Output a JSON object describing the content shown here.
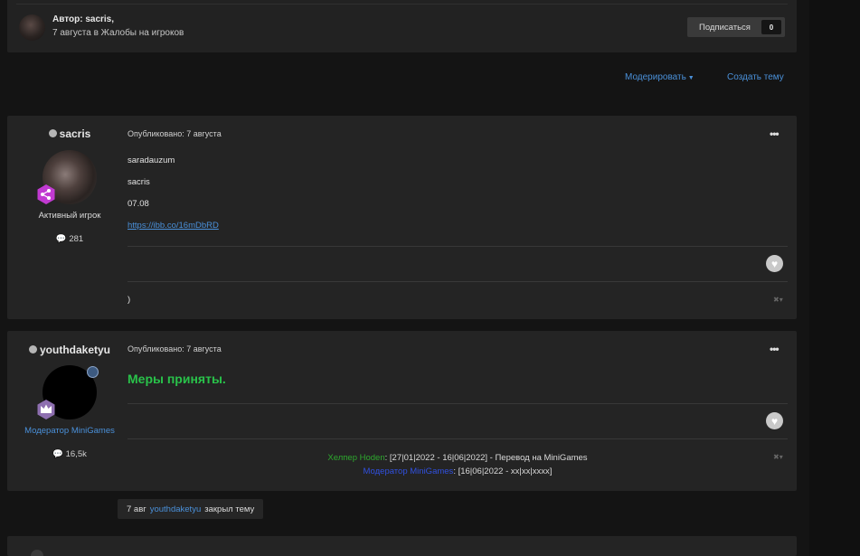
{
  "topic": {
    "author_label": "Автор: sacris,",
    "date": "7 августа",
    "in_word": "в",
    "forum": "Жалобы на игроков",
    "subscribe_label": "Подписаться",
    "subscribe_count": "0"
  },
  "actions": {
    "moderate_label": "Модерировать",
    "create_label": "Создать тему"
  },
  "posts": [
    {
      "author": "sacris",
      "group": "Активный игрок",
      "posts_count": "281",
      "date": "Опубликовано: 7 августа",
      "lines": [
        "saradauzum",
        "sacris",
        "07.08"
      ],
      "link": "https://ibb.co/16mDbRD",
      "signature": ")"
    },
    {
      "author": "youthdaketyu",
      "group": "Модератор MiniGames",
      "posts_count": "16,5k",
      "date": "Опубликовано: 7 августа",
      "title": "Меры приняты.",
      "sig1_role": "Хелпер Hoden",
      "sig1_text": ": [27|01|2022 - 16|06|2022] - Перевод на MiniGames",
      "sig2_role": "Модератор MiniGames",
      "sig2_text": ": [16|06|2022 - xx|xx|xxxx]"
    }
  ],
  "event": {
    "date": "7 авг",
    "user": "youthdaketyu",
    "action": "закрыл тему"
  },
  "icons": {
    "menu": "ellipsis-icon",
    "like": "heart-icon",
    "comments": "comment-icon",
    "rank_member": "share-badge-icon",
    "rank_mod": "crown-badge-icon",
    "mod_shield": "shield-icon"
  },
  "colors": {
    "link": "#4a90d9",
    "accepted": "#29c24a",
    "helper": "#2ea82e",
    "moderator": "#3050e0"
  }
}
